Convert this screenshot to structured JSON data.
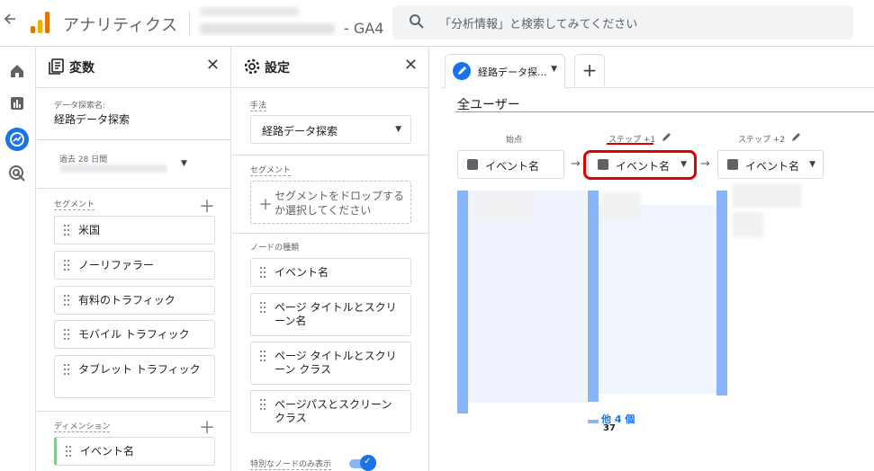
{
  "topbar": {
    "back_icon": "back-arrow-icon",
    "app_title": "アナリティクス",
    "property_suffix": "- GA4",
    "search_placeholder": "「分析情報」と検索してみてください"
  },
  "rail": {
    "icons": [
      "home-icon",
      "reports-icon",
      "explore-icon",
      "advertising-icon"
    ],
    "active_index": 2
  },
  "variables": {
    "title": "変数",
    "exploration_name_label": "データ探索名:",
    "exploration_name": "経路データ探索",
    "date_label": "過去 28 日間",
    "segments_label": "セグメント",
    "segments": [
      "米国",
      "ノーリファラー",
      "有料のトラフィック",
      "モバイル トラフィック",
      "タブレット トラフィック"
    ],
    "dimensions_label": "ディメンション",
    "dimensions": [
      "イベント名"
    ]
  },
  "settings": {
    "title": "設定",
    "technique_label": "手法",
    "technique_value": "経路データ探索",
    "segment_label": "セグメント",
    "segment_drop_text": "セグメントをドロップするか選択してください",
    "node_type_label": "ノードの種類",
    "node_types": [
      "イベント名",
      "ページ タイトルとスクリーン名",
      "ページ タイトルとスクリーン クラス",
      "ページパスとスクリーン クラス"
    ],
    "unique_nodes_label": "特別なノードのみ表示",
    "unique_nodes_on": true
  },
  "canvas": {
    "tab_label": "経路データ探...",
    "all_users": "全ユーザー",
    "start_label": "始点",
    "step1_label": "ステップ +1",
    "step2_label": "ステップ +2",
    "node_label": "イベント名",
    "more_label": "他 4 個",
    "more_count": "37",
    "highlight_color": "#e00000",
    "bar_color": "#8ab4f8"
  }
}
